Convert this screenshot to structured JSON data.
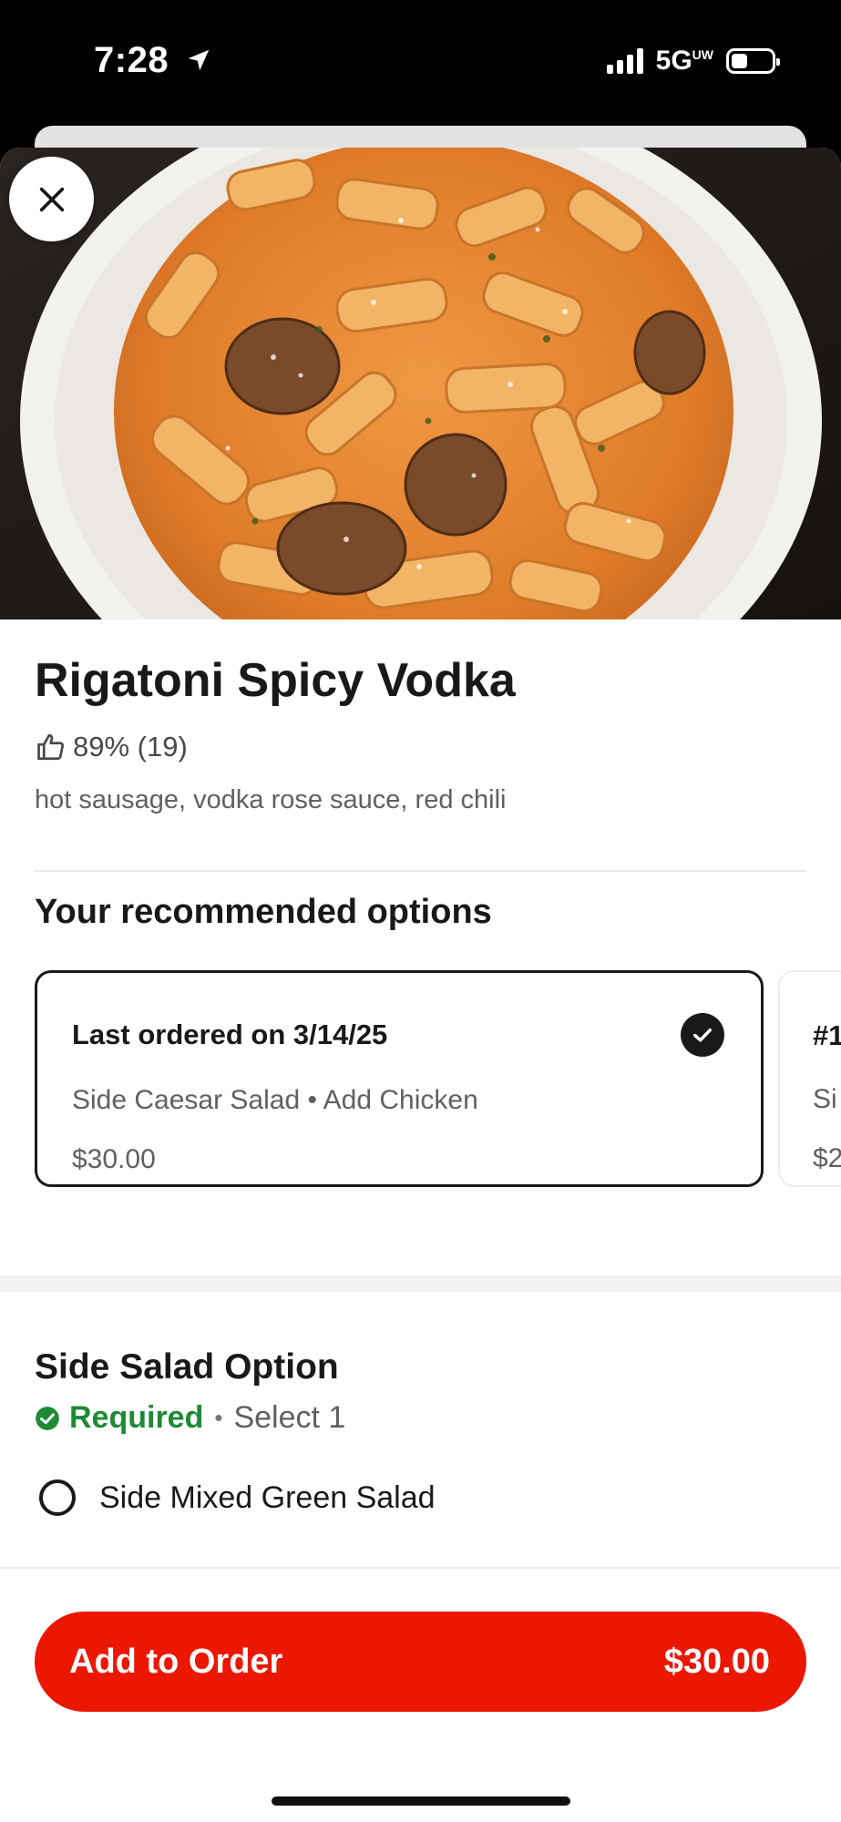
{
  "status_bar": {
    "time": "7:28",
    "network": "5G",
    "network_suffix": "UW"
  },
  "item": {
    "image_alt": "Rigatoni pasta with sausage in vodka rose sauce",
    "title": "Rigatoni Spicy Vodka",
    "rating": "89% (19)",
    "description": "hot sausage, vodka rose sauce, red chili"
  },
  "recommended": {
    "heading": "Your recommended options",
    "cards": [
      {
        "title": "Last ordered on 3/14/25",
        "items": "Side Caesar Salad • Add Chicken",
        "price": "$30.00",
        "selected": true
      },
      {
        "title": "#1",
        "items": "Si",
        "price": "$2",
        "selected": false
      }
    ]
  },
  "side_salad": {
    "heading": "Side Salad Option",
    "required_label": "Required",
    "separator": "•",
    "select_hint": "Select 1",
    "options": [
      {
        "label": "Side Mixed Green Salad",
        "selected": false
      }
    ]
  },
  "cta": {
    "label": "Add to Order",
    "price": "$30.00"
  },
  "colors": {
    "brand_red": "#eb1700",
    "required_green": "#1e8a35",
    "text_primary": "#191919",
    "text_secondary": "#606060"
  },
  "icons": {
    "close": "close-icon",
    "thumbs_up": "thumbs-up-icon",
    "check": "checkmark-icon",
    "required": "check-circle-icon",
    "location": "location-arrow-icon"
  }
}
